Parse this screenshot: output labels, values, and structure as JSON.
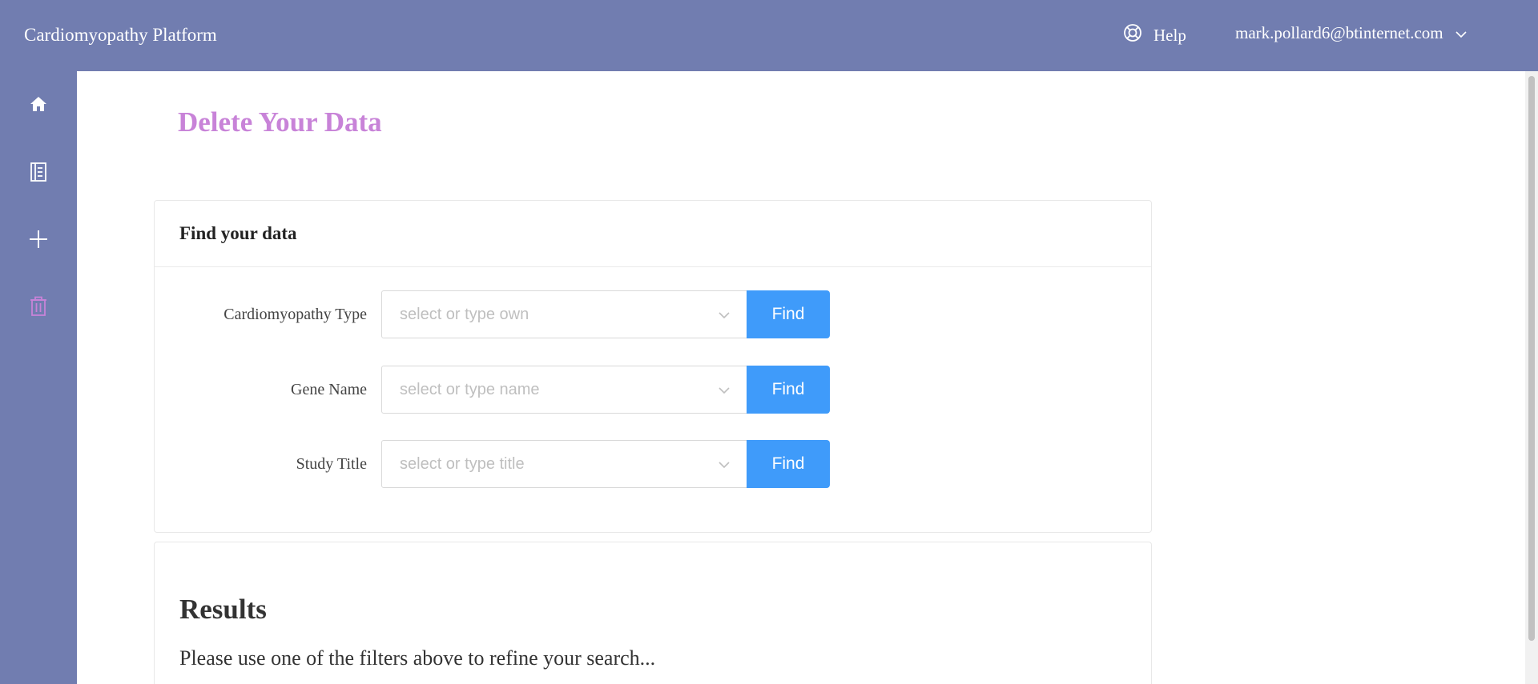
{
  "header": {
    "brand": "Cardiomyopathy Platform",
    "help_label": "Help",
    "user_email": "mark.pollard6@btinternet.com"
  },
  "sidebar": {
    "items": [
      {
        "name": "home",
        "icon": "home-icon"
      },
      {
        "name": "studies",
        "icon": "notebook-icon"
      },
      {
        "name": "add",
        "icon": "plus-icon"
      },
      {
        "name": "delete",
        "icon": "trash-icon",
        "active": true
      }
    ]
  },
  "page": {
    "title": "Delete Your Data"
  },
  "find_card": {
    "title": "Find your data",
    "rows": [
      {
        "label": "Cardiomyopathy Type",
        "placeholder": "select or type own",
        "button": "Find"
      },
      {
        "label": "Gene Name",
        "placeholder": "select or type name",
        "button": "Find"
      },
      {
        "label": "Study Title",
        "placeholder": "select or type title",
        "button": "Find"
      }
    ]
  },
  "results": {
    "title": "Results",
    "message": "Please use one of the filters above to refine your search..."
  },
  "colors": {
    "header_bg": "#717db0",
    "title_accent": "#c883d8",
    "button_blue": "#3f9bfa",
    "active_icon": "#c883d8"
  }
}
